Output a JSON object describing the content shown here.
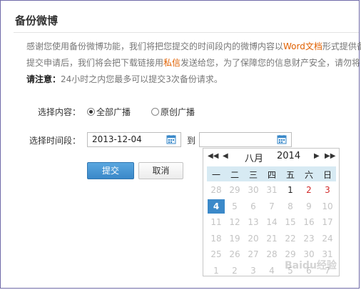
{
  "title": "备份微博",
  "desc": {
    "line1_a": "感谢您使用备份微博功能，我们将把您提交的时间段内的微博内容以",
    "line1_hl": "Word文档",
    "line1_b": "形式提供备",
    "line2_a": "提交申请后，我们将会把下载链接用",
    "line2_hl": "私信",
    "line2_b": "发送给您，为了保障您的信息财产安全，请勿将",
    "warn_label": "请注意：",
    "warn_text": "24小时之内您最多可以提交3次备份请求。"
  },
  "form": {
    "content_label": "选择内容：",
    "content_options": [
      "全部广播",
      "原创广播"
    ],
    "selected_option": "全部广播",
    "time_label": "选择时间段：",
    "start_date": "2013-12-04",
    "to_label": "到",
    "end_date": "",
    "submit_label": "提交",
    "cancel_label": "取消"
  },
  "calendar": {
    "month": "八月",
    "year": "2014",
    "weekdays": [
      "一",
      "二",
      "三",
      "四",
      "五",
      "六",
      "日"
    ],
    "selected_day": "4",
    "weeks": [
      [
        "28",
        "29",
        "30",
        "31",
        "1",
        "2",
        "3"
      ],
      [
        "4",
        "5",
        "6",
        "7",
        "8",
        "9",
        "10"
      ],
      [
        "11",
        "12",
        "13",
        "14",
        "15",
        "16",
        "17"
      ],
      [
        "18",
        "19",
        "20",
        "21",
        "22",
        "23",
        "24"
      ],
      [
        "25",
        "26",
        "27",
        "28",
        "29",
        "30",
        "31"
      ],
      [
        "1",
        "2",
        "3",
        "4",
        "5",
        "6",
        "7"
      ]
    ]
  },
  "watermark": "Baidu经验",
  "colors": {
    "accent": "#3b89c9",
    "highlight": "#e06000",
    "weekend_red": "#d12a2a",
    "header_bg": "#d7eaf3"
  }
}
